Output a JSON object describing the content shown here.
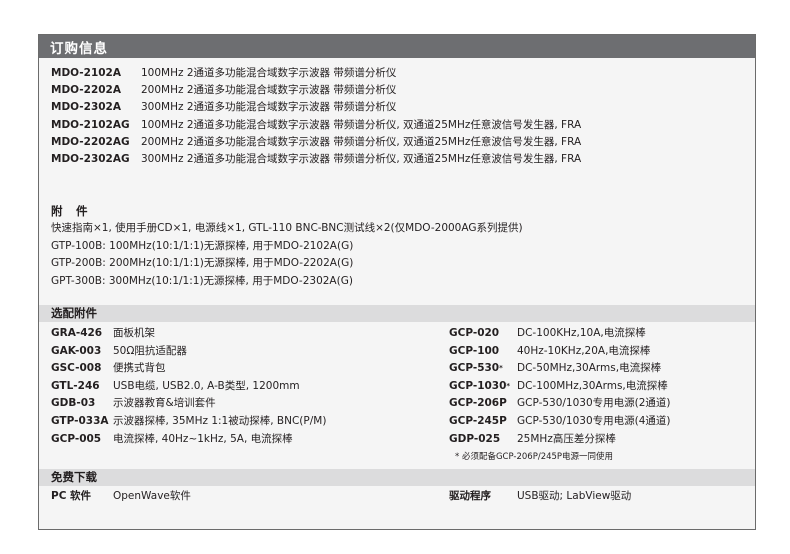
{
  "header": {
    "title": "订购信息"
  },
  "order": [
    {
      "model": "MDO-2102A",
      "desc": "100MHz 2通道多功能混合域数字示波器 带频谱分析仪"
    },
    {
      "model": "MDO-2202A",
      "desc": "200MHz 2通道多功能混合域数字示波器 带频谱分析仪"
    },
    {
      "model": "MDO-2302A",
      "desc": "300MHz 2通道多功能混合域数字示波器 带频谱分析仪"
    },
    {
      "model": "MDO-2102AG",
      "desc": "100MHz 2通道多功能混合域数字示波器 带频谱分析仪, 双通道25MHz任意波信号发生器, FRA"
    },
    {
      "model": "MDO-2202AG",
      "desc": "200MHz 2通道多功能混合域数字示波器 带频谱分析仪, 双通道25MHz任意波信号发生器, FRA"
    },
    {
      "model": "MDO-2302AG",
      "desc": "300MHz 2通道多功能混合域数字示波器 带频谱分析仪, 双通道25MHz任意波信号发生器, FRA"
    }
  ],
  "accessories": {
    "title": "附　件",
    "lines": [
      "快速指南×1, 使用手册CD×1, 电源线×1, GTL-110 BNC-BNC测试线×2(仅MDO-2000AG系列提供)",
      "GTP-100B: 100MHz(10:1/1:1)无源探棒, 用于MDO-2102A(G)",
      "GTP-200B: 200MHz(10:1/1:1)无源探棒, 用于MDO-2202A(G)",
      "GPT-300B: 300MHz(10:1/1:1)无源探棒, 用于MDO-2302A(G)"
    ]
  },
  "optional": {
    "title": "选配附件",
    "left": [
      {
        "code": "GRA-426",
        "desc": "面板机架"
      },
      {
        "code": "GAK-003",
        "desc": "50Ω阻抗适配器"
      },
      {
        "code": "GSC-008",
        "desc": "便携式背包"
      },
      {
        "code": "GTL-246",
        "desc": "USB电缆, USB2.0, A-B类型, 1200mm"
      },
      {
        "code": "GDB-03",
        "desc": "示波器教育&培训套件"
      },
      {
        "code": "GTP-033A",
        "desc": "示波器探棒, 35MHz 1:1被动探棒, BNC(P/M)"
      },
      {
        "code": "GCP-005",
        "desc": "电流探棒, 40Hz~1kHz, 5A, 电流探棒"
      }
    ],
    "right": [
      {
        "code": "GCP-020",
        "star": "",
        "desc": "DC-100KHz,10A,电流探棒"
      },
      {
        "code": "GCP-100",
        "star": "",
        "desc": "40Hz-10KHz,20A,电流探棒"
      },
      {
        "code": "GCP-530",
        "star": "*",
        "desc": "DC-50MHz,30Arms,电流探棒"
      },
      {
        "code": "GCP-1030",
        "star": "*",
        "desc": "DC-100MHz,30Arms,电流探棒"
      },
      {
        "code": "GCP-206P",
        "star": "",
        "desc": "GCP-530/1030专用电源(2通道)"
      },
      {
        "code": "GCP-245P",
        "star": "",
        "desc": "GCP-530/1030专用电源(4通道)"
      },
      {
        "code": "GDP-025",
        "star": "",
        "desc": "25MHz高压差分探棒"
      }
    ],
    "note": "* 必须配备GCP-206P/245P电源一同使用"
  },
  "download": {
    "title": "免费下载",
    "left": {
      "code": "PC 软件",
      "desc": "OpenWave软件"
    },
    "right": {
      "code": "驱动程序",
      "desc": "USB驱动; LabView驱动"
    }
  }
}
